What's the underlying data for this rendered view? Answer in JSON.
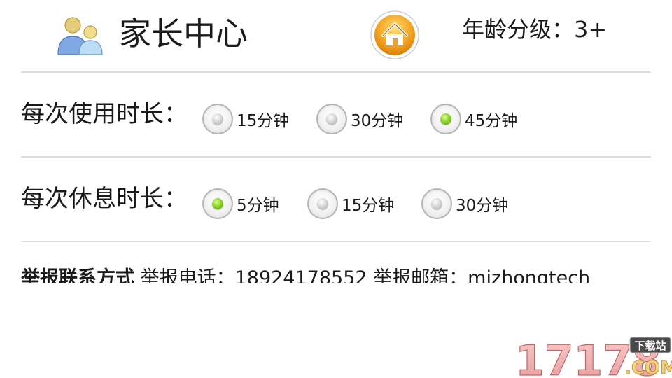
{
  "header": {
    "title": "家长中心",
    "home_icon": "home-icon",
    "parents_icon": "parents-icon",
    "age_rating": "年龄分级：3+"
  },
  "usage_duration": {
    "label": "每次使用时长：",
    "options": [
      "15分钟",
      "30分钟",
      "45分钟"
    ],
    "selected": "45分钟"
  },
  "rest_duration": {
    "label": "每次休息时长：",
    "options": [
      "5分钟",
      "15分钟",
      "30分钟"
    ],
    "selected": "5分钟"
  },
  "contact": {
    "heading": "举报联系方式",
    "text": "举报电话：18924178552 举报邮箱：mizhongtech"
  },
  "watermark": {
    "number": "17178",
    "tag": "下载站",
    "suffix": ".COM"
  },
  "colors": {
    "accent_green": "#8fd42a",
    "home_orange": "#f5a623",
    "divider": "#dcdcdc"
  }
}
